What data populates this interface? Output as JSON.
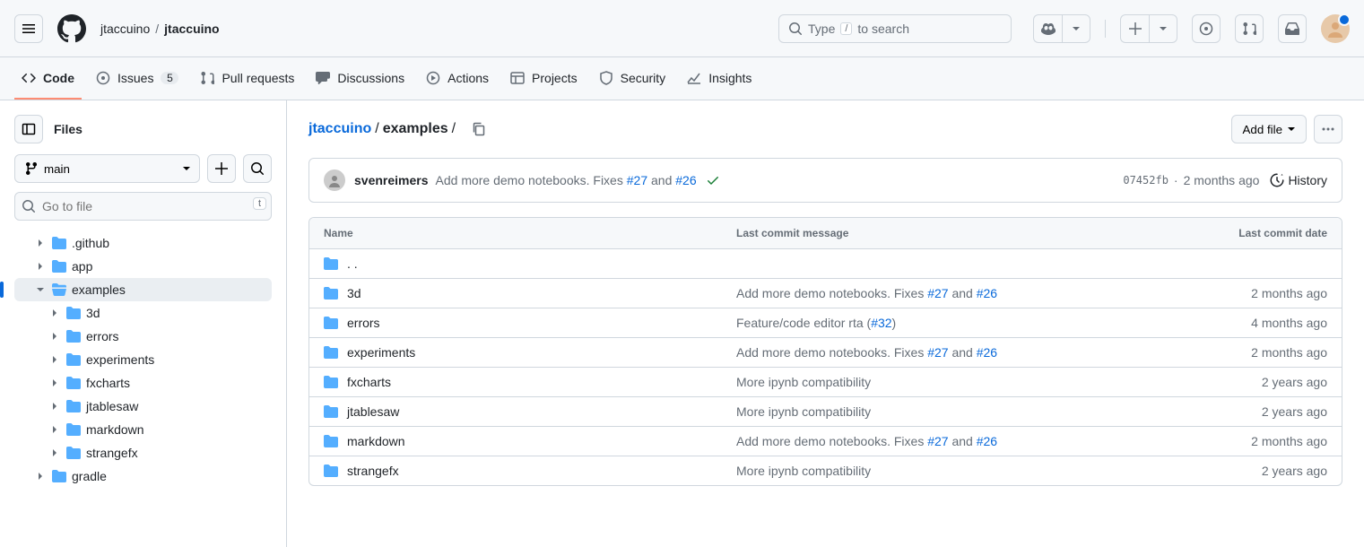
{
  "header": {
    "owner": "jtaccuino",
    "repo": "jtaccuino",
    "search_placeholder_pre": "Type",
    "search_placeholder_post": "to search",
    "search_key": "/"
  },
  "nav": {
    "code": "Code",
    "issues": "Issues",
    "issues_count": "5",
    "pulls": "Pull requests",
    "discussions": "Discussions",
    "actions": "Actions",
    "projects": "Projects",
    "security": "Security",
    "insights": "Insights"
  },
  "sidebar": {
    "title": "Files",
    "branch": "main",
    "file_search_placeholder": "Go to file",
    "file_search_key": "t",
    "tree": [
      {
        "name": ".github",
        "depth": 1,
        "expanded": false
      },
      {
        "name": "app",
        "depth": 1,
        "expanded": false
      },
      {
        "name": "examples",
        "depth": 1,
        "expanded": true,
        "active": true
      },
      {
        "name": "3d",
        "depth": 2,
        "expanded": false
      },
      {
        "name": "errors",
        "depth": 2,
        "expanded": false
      },
      {
        "name": "experiments",
        "depth": 2,
        "expanded": false
      },
      {
        "name": "fxcharts",
        "depth": 2,
        "expanded": false
      },
      {
        "name": "jtablesaw",
        "depth": 2,
        "expanded": false
      },
      {
        "name": "markdown",
        "depth": 2,
        "expanded": false
      },
      {
        "name": "strangefx",
        "depth": 2,
        "expanded": false
      },
      {
        "name": "gradle",
        "depth": 1,
        "expanded": false
      }
    ]
  },
  "path": {
    "repo": "jtaccuino",
    "current": "examples",
    "add_file": "Add file"
  },
  "commit": {
    "author": "svenreimers",
    "msg_prefix": "Add more demo notebooks. Fixes ",
    "issue1": "#27",
    "and": " and ",
    "issue2": "#26",
    "sha": "07452fb",
    "date": "2 months ago",
    "history": "History"
  },
  "table": {
    "headers": {
      "name": "Name",
      "msg": "Last commit message",
      "date": "Last commit date"
    },
    "parent": ". .",
    "rows": [
      {
        "name": "3d",
        "msg_prefix": "Add more demo notebooks. Fixes ",
        "issue1": "#27",
        "and": " and ",
        "issue2": "#26",
        "msg_suffix": "",
        "date": "2 months ago"
      },
      {
        "name": "errors",
        "msg_prefix": "Feature/code editor rta (",
        "issue1": "#32",
        "and": "",
        "issue2": "",
        "msg_suffix": ")",
        "date": "4 months ago"
      },
      {
        "name": "experiments",
        "msg_prefix": "Add more demo notebooks. Fixes ",
        "issue1": "#27",
        "and": " and ",
        "issue2": "#26",
        "msg_suffix": "",
        "date": "2 months ago"
      },
      {
        "name": "fxcharts",
        "msg_prefix": "More ipynb compatibility",
        "issue1": "",
        "and": "",
        "issue2": "",
        "msg_suffix": "",
        "date": "2 years ago"
      },
      {
        "name": "jtablesaw",
        "msg_prefix": "More ipynb compatibility",
        "issue1": "",
        "and": "",
        "issue2": "",
        "msg_suffix": "",
        "date": "2 years ago"
      },
      {
        "name": "markdown",
        "msg_prefix": "Add more demo notebooks. Fixes ",
        "issue1": "#27",
        "and": " and ",
        "issue2": "#26",
        "msg_suffix": "",
        "date": "2 months ago"
      },
      {
        "name": "strangefx",
        "msg_prefix": "More ipynb compatibility",
        "issue1": "",
        "and": "",
        "issue2": "",
        "msg_suffix": "",
        "date": "2 years ago"
      }
    ]
  }
}
